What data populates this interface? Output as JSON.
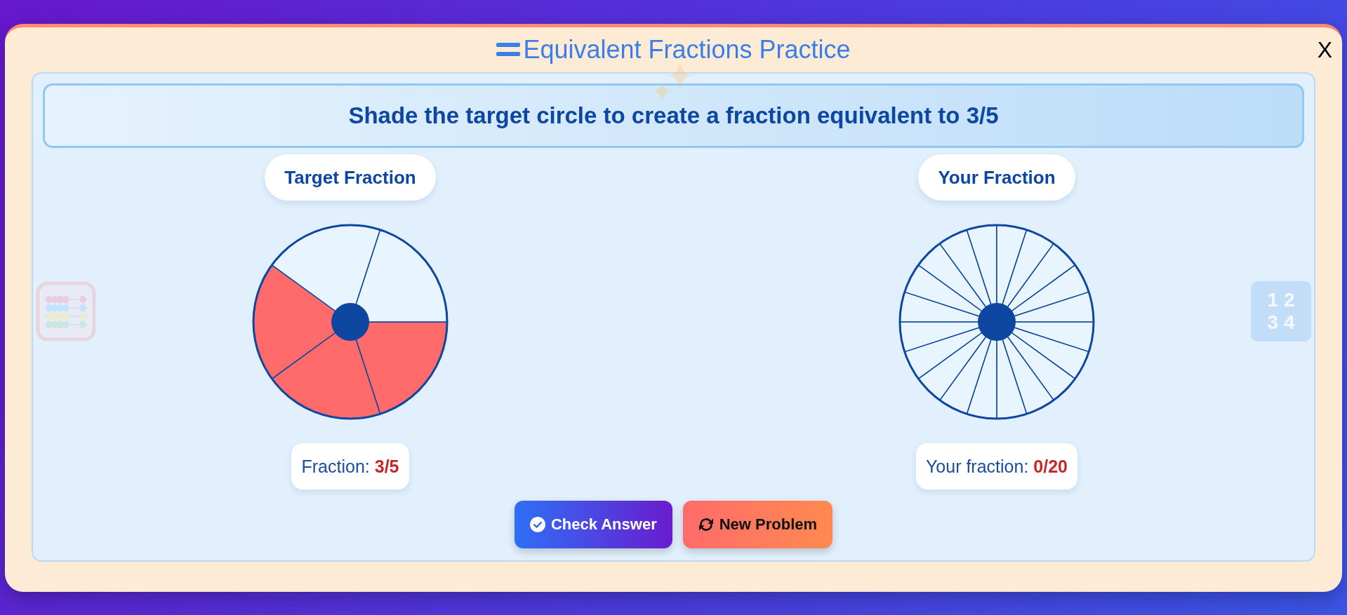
{
  "title": {
    "text": "Equivalent Fractions Practice"
  },
  "close_button": {
    "label": "X"
  },
  "instruction": "Shade the target circle to create a fraction equivalent to 3/5",
  "panels": [
    {
      "heading": "Target Fraction",
      "sectors": [
        {
          "shaded": true
        },
        {
          "shaded": true
        },
        {
          "shaded": true
        },
        {
          "shaded": false
        },
        {
          "shaded": false
        }
      ],
      "readout": {
        "label": "Fraction:",
        "value": "3/5"
      }
    },
    {
      "heading": "Your Fraction",
      "sectors": [
        {
          "shaded": false
        },
        {
          "shaded": false
        },
        {
          "shaded": false
        },
        {
          "shaded": false
        },
        {
          "shaded": false
        },
        {
          "shaded": false
        },
        {
          "shaded": false
        },
        {
          "shaded": false
        },
        {
          "shaded": false
        },
        {
          "shaded": false
        },
        {
          "shaded": false
        },
        {
          "shaded": false
        },
        {
          "shaded": false
        },
        {
          "shaded": false
        },
        {
          "shaded": false
        },
        {
          "shaded": false
        },
        {
          "shaded": false
        },
        {
          "shaded": false
        },
        {
          "shaded": false
        },
        {
          "shaded": false
        }
      ],
      "readout": {
        "label": "Your fraction:",
        "value": "0/20"
      }
    }
  ],
  "buttons": [
    {
      "kind": "check",
      "label": "Check Answer"
    },
    {
      "kind": "new",
      "label": "New Problem"
    }
  ],
  "decorations": {
    "number_tile": [
      "1 2",
      "3 4"
    ]
  }
}
